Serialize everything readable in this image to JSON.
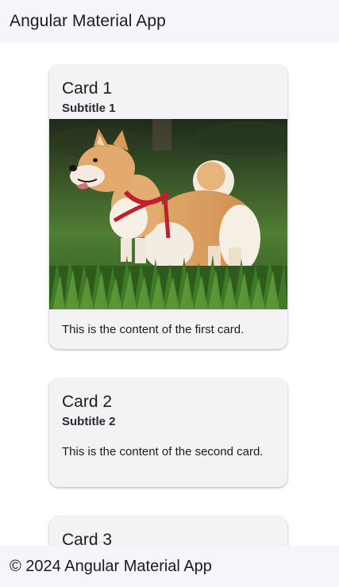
{
  "toolbar": {
    "title": "Angular Material App"
  },
  "cards": [
    {
      "title": "Card 1",
      "subtitle": "Subtitle 1",
      "image": "dog-photo",
      "content": "This is the content of the first card."
    },
    {
      "title": "Card 2",
      "subtitle": "Subtitle 2",
      "content": "This is the content of the second card."
    },
    {
      "title": "Card 3"
    }
  ],
  "footer": {
    "text": "© 2024 Angular Material App"
  }
}
